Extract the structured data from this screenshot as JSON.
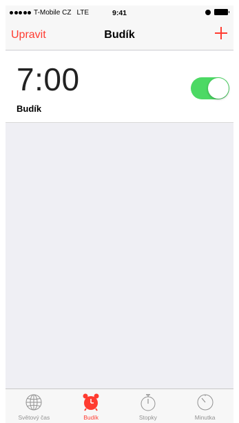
{
  "status_bar": {
    "carrier": "T-Mobile CZ",
    "network": "LTE",
    "time": "9:41"
  },
  "nav": {
    "edit_label": "Upravit",
    "title": "Budík",
    "add_icon": "plus-icon"
  },
  "alarms": [
    {
      "time": "7:00",
      "label": "Budík",
      "enabled": true
    }
  ],
  "tabs": [
    {
      "label": "Světový čas",
      "icon": "globe-icon",
      "active": false
    },
    {
      "label": "Budík",
      "icon": "alarm-clock-icon",
      "active": true
    },
    {
      "label": "Stopky",
      "icon": "stopwatch-icon",
      "active": false
    },
    {
      "label": "Minutka",
      "icon": "timer-icon",
      "active": false
    }
  ],
  "colors": {
    "accent": "#ff3b30",
    "toggle_on": "#4cd964",
    "inactive_tab": "#929292",
    "background": "#efeff4"
  }
}
